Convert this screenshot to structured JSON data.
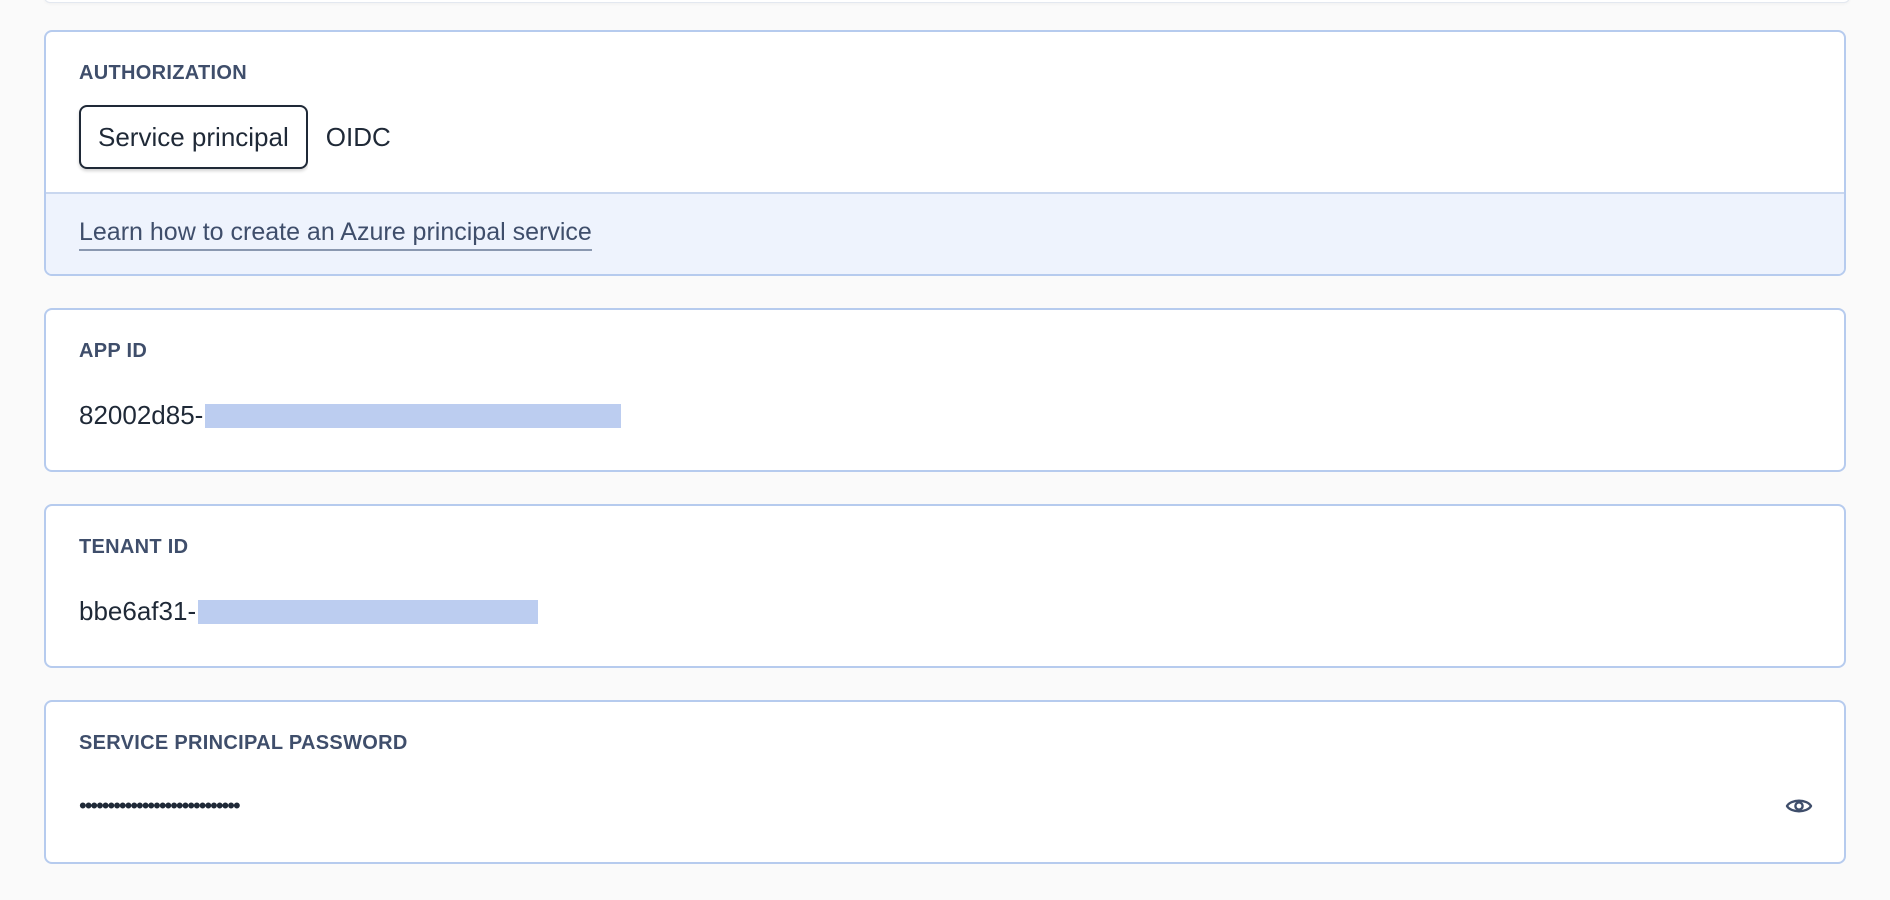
{
  "authorization": {
    "label": "AUTHORIZATION",
    "options": [
      {
        "label": "Service principal",
        "selected": true
      },
      {
        "label": "OIDC",
        "selected": false
      }
    ],
    "help_link": "Learn how to create an Azure principal service"
  },
  "app_id": {
    "label": "APP ID",
    "value_visible": "82002d85-",
    "redacted": true
  },
  "tenant_id": {
    "label": "TENANT ID",
    "value_visible": "bbe6af31-",
    "redacted": true
  },
  "service_principal_password": {
    "label": "SERVICE PRINCIPAL PASSWORD",
    "masked_value": "••••••••••••••••••••••••••••",
    "toggle_icon": "eye-icon"
  },
  "colors": {
    "card_border": "#b6cbee",
    "help_band_bg": "#eef3fd",
    "redaction": "#bccdf0",
    "label_text": "#3f4e6b",
    "body_text": "#1f2937"
  }
}
